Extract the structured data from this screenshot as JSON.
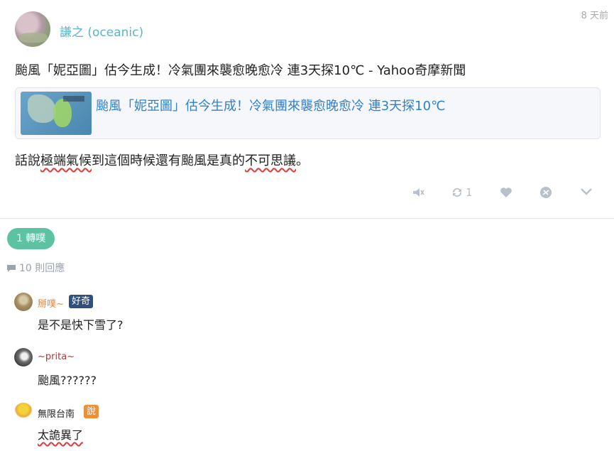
{
  "post": {
    "author": "謙之 (oceanic)",
    "timestamp": "8 天前",
    "text": "颱風「妮亞圖」估今生成！冷氣團來襲愈晚愈冷 連3天探10℃ - Yahoo奇摩新聞",
    "link_title": "颱風「妮亞圖」估今生成！冷氣團來襲愈晚愈冷 連3天探10℃",
    "comment": {
      "part1": "話說",
      "part2": "極端氣候",
      "part3": "到這個時候還有颱風是真的",
      "part4": "不可思議",
      "part5": "。"
    },
    "actions": {
      "replurk_count": "1",
      "icons": [
        "mute-icon",
        "replurk-icon",
        "like-icon",
        "gift-icon",
        "more-icon"
      ]
    }
  },
  "replurk_badge": "1 轉噗",
  "responses_count": "10 則回應",
  "responses": [
    {
      "name": "掰噗~",
      "qualifier": "好奇",
      "text": "是不是快下雪了?",
      "name_color": "#e8843a",
      "qual_color": "#2f4f7f"
    },
    {
      "name": "~prita~",
      "qualifier": "",
      "text": "颱風??????",
      "name_color": "#c23030",
      "qual_color": ""
    },
    {
      "name": "無限台南",
      "qualifier": "說",
      "text": "太詭異了",
      "name_color": "#222222",
      "qual_color": "#e8913a"
    }
  ],
  "colors": {
    "accent_teal": "#5bb4c7",
    "link_blue": "#2f7fcf",
    "replurk_green": "#5cc2a1",
    "icon_grey": "#b8c0cc"
  }
}
